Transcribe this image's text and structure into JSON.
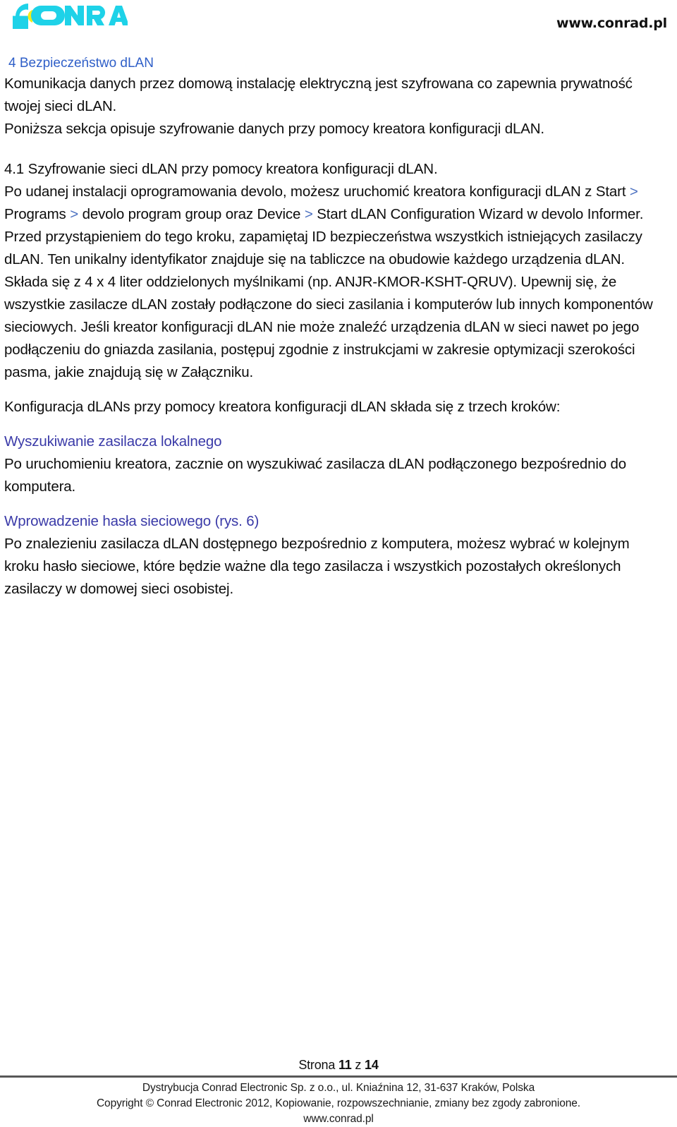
{
  "header": {
    "logo_text": "CONRAD",
    "logo_colors": {
      "cyan": "#1ed2e8",
      "yellow": "#f3ec1a"
    },
    "site_url": "www.conrad.pl"
  },
  "colors": {
    "heading_blue": "#2f5fc8",
    "subhead_blue": "#3a3aa8",
    "chevron_blue": "#4a6fc0",
    "body_text": "#0d0d0d",
    "rule_gray": "#585858"
  },
  "content": {
    "section_heading": "4 Bezpieczeństwo  dLAN",
    "intro_paragraph": "Komunikacja danych przez domową instalację elektryczną jest szyfrowana co zapewnia prywatność twojej sieci dLAN.",
    "intro_paragraph_2": "Poniższa sekcja opisuje szyfrowanie danych przy pomocy kreatora konfiguracji dLAN.",
    "subsection_heading": "4.1 Szyfrowanie sieci dLAN przy pomocy kreatora konfiguracji dLAN.",
    "path_para": {
      "part1": "Po udanej instalacji oprogramowania devolo, możesz uruchomić kreatora konfiguracji dLAN z Start ",
      "chev1": ">",
      "part2": " Programs ",
      "chev2": ">",
      "part3": " devolo program group oraz Device ",
      "chev3": ">",
      "part4": " Start dLAN Configuration Wizard w devolo Informer."
    },
    "security_id_para": "Przed przystąpieniem do tego kroku,  zapamiętaj ID bezpieczeństwa wszystkich istniejących zasilaczy dLAN. Ten unikalny identyfikator znajduje się na tabliczce na obudowie każdego urządzenia  dLAN. Składa się z 4 x 4 liter oddzielonych myślnikami (np.  ANJR-KMOR-KSHT-QRUV). Upewnij się, że wszystkie zasilacze dLAN zostały podłączone do sieci zasilania  i komputerów lub innych komponentów sieciowych. Jeśli kreator konfiguracji dLAN nie może znaleźć urządzenia dLAN w sieci nawet po jego podłączeniu do gniazda zasilania, postępuj zgodnie z instrukcjami w zakresie optymizacji szerokości pasma, jakie znajdują się w Załączniku.",
    "three_steps_para": "Konfiguracja dLANs przy pomocy kreatora konfiguracji dLAN składa się z trzech kroków:",
    "step1_heading": "Wyszukiwanie zasilacza lokalnego",
    "step1_para": "Po uruchomieniu kreatora, zacznie on wyszukiwać zasilacza dLAN podłączonego bezpośrednio do komputera.",
    "step2_heading": "Wprowadzenie hasła sieciowego (rys. 6)",
    "step2_para": "Po znalezieniu zasilacza dLAN dostępnego bezpośrednio z komputera, możesz wybrać w kolejnym kroku hasło sieciowe, które będzie ważne dla tego zasilacza i wszystkich pozostałych określonych zasilaczy w domowej sieci osobistej."
  },
  "footer": {
    "page_label": "Strona",
    "page_current": "11",
    "page_of": "z",
    "page_total": "14",
    "line1": "Dystrybucja Conrad Electronic Sp. z o.o., ul. Kniaźnina 12, 31-637 Kraków, Polska",
    "line2": "Copyright © Conrad Electronic 2012, Kopiowanie, rozpowszechnianie, zmiany bez zgody zabronione.",
    "line3": "www.conrad.pl"
  }
}
